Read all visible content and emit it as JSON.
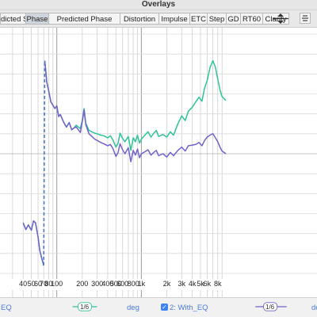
{
  "window": {
    "title": "Overlays"
  },
  "tabs": [
    {
      "label": "dicted SPL",
      "active": false
    },
    {
      "label": "Phase",
      "active": true
    },
    {
      "label": "Predicted Phase",
      "active": false
    },
    {
      "label": "Distortion",
      "active": false
    },
    {
      "label": "Impulse",
      "active": false
    },
    {
      "label": "ETC",
      "active": false
    },
    {
      "label": "Step",
      "active": false
    },
    {
      "label": "GD",
      "active": false
    },
    {
      "label": "RT60",
      "active": false
    },
    {
      "label": "Clarity",
      "active": false
    }
  ],
  "toolbar_icons": [
    "adjust-arrows-icon",
    "stack-icon"
  ],
  "chart_data": {
    "type": "line",
    "xscale": "log",
    "xlim": [
      30,
      10000
    ],
    "xticks": [
      "40",
      "50",
      "60",
      "70",
      "80",
      "100",
      "200",
      "300",
      "400",
      "500",
      "600",
      "800",
      "1k",
      "2k",
      "3k",
      "4k",
      "5k",
      "6k",
      "8k"
    ],
    "xtick_values": [
      40,
      50,
      60,
      70,
      80,
      100,
      200,
      300,
      400,
      500,
      600,
      800,
      1000,
      2000,
      3000,
      4000,
      5000,
      6000,
      8000
    ],
    "ylim": [
      -180,
      180
    ],
    "grid": true,
    "colors": {
      "series1": "#2ec39a",
      "series2": "#7461c8",
      "overlap": "#4a79c6"
    },
    "series": [
      {
        "name": "EQ",
        "x": [
          40,
          43,
          46,
          50,
          53,
          56,
          60,
          63,
          66,
          70,
          72,
          74,
          76,
          80,
          85,
          90,
          95,
          100,
          105,
          110,
          120,
          130,
          140,
          150,
          160,
          170,
          180,
          190,
          200,
          210,
          220,
          240,
          260,
          280,
          300,
          330,
          360,
          400,
          430,
          460,
          500,
          530,
          560,
          600,
          640,
          700,
          750,
          800,
          850,
          900,
          950,
          1000,
          1100,
          1200,
          1300,
          1400,
          1500,
          1600,
          1800,
          2000,
          2200,
          2400,
          2700,
          3000,
          3300,
          3600,
          4000,
          4400,
          4800,
          5200,
          5600,
          6000,
          6500,
          7000,
          7500,
          8000,
          8500,
          9000,
          10000
        ],
        "y": [
          -104,
          -114,
          -107,
          -115,
          -101,
          -104,
          -125,
          -146,
          -156,
          -168,
          140,
          125,
          108,
          95,
          78,
          73,
          68,
          72,
          56,
          59,
          48,
          40,
          47,
          36,
          39,
          43,
          40,
          38,
          50,
          68,
          46,
          35,
          33,
          31,
          30,
          28,
          27,
          24,
          27,
          21,
          10,
          16,
          31,
          23,
          18,
          26,
          5,
          24,
          18,
          28,
          16,
          22,
          28,
          33,
          25,
          31,
          35,
          26,
          29,
          25,
          33,
          28,
          45,
          57,
          50,
          64,
          70,
          78,
          85,
          79,
          99,
          110,
          130,
          140,
          130,
          112,
          96,
          86,
          80
        ]
      },
      {
        "name": "2: With_EQ",
        "x": [
          40,
          43,
          46,
          50,
          53,
          56,
          60,
          63,
          66,
          70,
          72,
          74,
          76,
          80,
          85,
          90,
          95,
          100,
          105,
          110,
          120,
          130,
          140,
          150,
          160,
          170,
          180,
          190,
          200,
          210,
          220,
          240,
          260,
          280,
          300,
          330,
          360,
          400,
          430,
          460,
          500,
          530,
          560,
          600,
          640,
          700,
          750,
          800,
          850,
          900,
          950,
          1000,
          1100,
          1200,
          1300,
          1400,
          1500,
          1600,
          1800,
          2000,
          2200,
          2400,
          2700,
          3000,
          3300,
          3600,
          4000,
          4400,
          4800,
          5200,
          5600,
          6000,
          6500,
          7000,
          7500,
          8000,
          8500,
          9000,
          10000
        ],
        "y": [
          -104,
          -114,
          -107,
          -115,
          -101,
          -104,
          -125,
          -146,
          -156,
          -168,
          140,
          125,
          108,
          95,
          78,
          73,
          68,
          72,
          56,
          59,
          48,
          40,
          47,
          36,
          39,
          40,
          36,
          32,
          48,
          66,
          44,
          30,
          26,
          22,
          20,
          17,
          15,
          12,
          14,
          8,
          -4,
          2,
          15,
          6,
          0,
          9,
          -12,
          5,
          -2,
          7,
          -6,
          0,
          3,
          6,
          -2,
          2,
          5,
          -3,
          0,
          -5,
          2,
          -3,
          5,
          10,
          4,
          12,
          13,
          14,
          17,
          12,
          20,
          25,
          28,
          30,
          24,
          18,
          10,
          4,
          0
        ]
      }
    ]
  },
  "legend": {
    "item1_label": "EQ",
    "item1_smoothing": "1/6",
    "item1_unit": "deg",
    "item2_label": "2: With_EQ",
    "item2_smoothing": "1/6",
    "item2_unit": "deg"
  }
}
